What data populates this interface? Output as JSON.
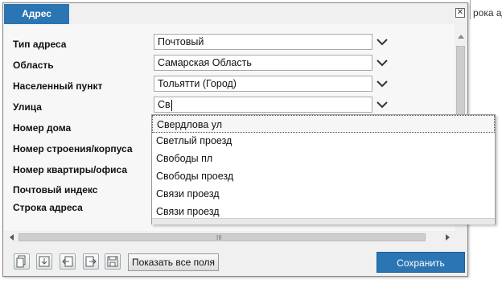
{
  "background_text": "рока ад",
  "dialog": {
    "tab_label": "Адрес",
    "close_icon": "close-icon",
    "fields": [
      {
        "label": "Тип адреса",
        "value": "Почтовый",
        "has_dropdown": true
      },
      {
        "label": "Область",
        "value": "Самарская Область",
        "has_dropdown": true
      },
      {
        "label": "Населенный пункт",
        "value": "Тольятти (Город)",
        "has_dropdown": true
      },
      {
        "label": "Улица",
        "value": "Св",
        "has_dropdown": true
      },
      {
        "label": "Номер дома"
      },
      {
        "label": "Номер строения/корпуса"
      },
      {
        "label": "Номер квартиры/офиса"
      },
      {
        "label": "Почтовый индекс"
      },
      {
        "label": "Строка адреса"
      }
    ],
    "suggestions": [
      "Свердлова ул",
      "Светлый проезд",
      "Свободы пл",
      "Свободы проезд",
      "Связи проезд",
      "Связи проезд"
    ],
    "scroll_grip": "III",
    "toolbar_icons": [
      "copy-icon",
      "import-icon",
      "move-left-icon",
      "move-right-icon",
      "save-disk-icon"
    ],
    "show_all_label": "Показать все поля",
    "save_label": "Сохранить"
  },
  "colors": {
    "accent": "#2b75b3"
  }
}
